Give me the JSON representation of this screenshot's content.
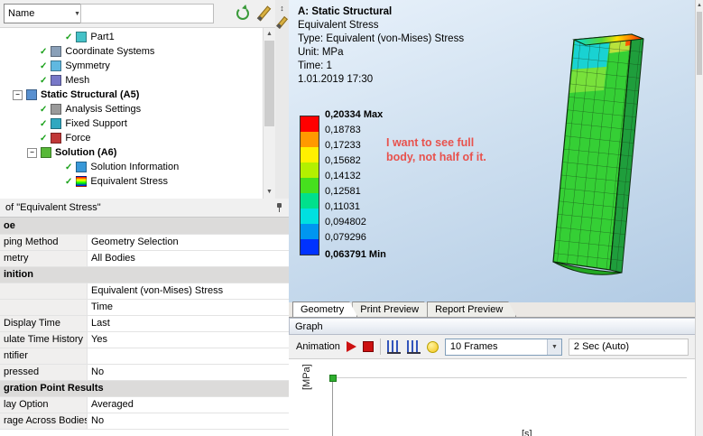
{
  "tree_panel": {
    "name_filter_label": "Name",
    "items": [
      {
        "label": "Part1"
      },
      {
        "label": "Coordinate Systems"
      },
      {
        "label": "Symmetry"
      },
      {
        "label": "Mesh"
      },
      {
        "label": "Static Structural (A5)"
      },
      {
        "label": "Analysis Settings"
      },
      {
        "label": "Fixed Support"
      },
      {
        "label": "Force"
      },
      {
        "label": "Solution (A6)"
      },
      {
        "label": "Solution Information"
      },
      {
        "label": "Equivalent Stress"
      }
    ]
  },
  "details_panel": {
    "title": "of \"Equivalent Stress\"",
    "rows": [
      {
        "label": "oe",
        "value": ""
      },
      {
        "label": "ping Method",
        "value": "Geometry Selection"
      },
      {
        "label": "metry",
        "value": "All Bodies"
      },
      {
        "label": "inition",
        "value": ""
      },
      {
        "label": "",
        "value": "Equivalent (von-Mises) Stress"
      },
      {
        "label": "",
        "value": "Time"
      },
      {
        "label": "Display Time",
        "value": "Last"
      },
      {
        "label": "ulate Time History",
        "value": "Yes"
      },
      {
        "label": "ntifier",
        "value": ""
      },
      {
        "label": "pressed",
        "value": "No"
      },
      {
        "label": "gration Point Results",
        "value": ""
      },
      {
        "label": "lay Option",
        "value": "Averaged"
      },
      {
        "label": "rage Across Bodies",
        "value": "No"
      }
    ]
  },
  "viewport": {
    "header_lines": [
      "A: Static Structural",
      "Equivalent Stress",
      "Type: Equivalent (von-Mises) Stress",
      "Unit: MPa",
      "Time: 1",
      "1.01.2019 17:30"
    ],
    "legend": {
      "values": [
        "0,20334 Max",
        "0,18783",
        "0,17233",
        "0,15682",
        "0,14132",
        "0,12581",
        "0,11031",
        "0,094802",
        "0,079296",
        "0,063791 Min"
      ],
      "colors": [
        "#ff0000",
        "#ff9900",
        "#fff000",
        "#b3f000",
        "#46e01e",
        "#00e08c",
        "#00e0e0",
        "#0096f0",
        "#0032ff"
      ]
    },
    "annotation": {
      "lines": [
        "I want to see full",
        "body, not half of it."
      ],
      "color": "#e8524d"
    },
    "tabs": [
      "Geometry",
      "Print Preview",
      "Report Preview"
    ]
  },
  "graph_panel": {
    "title": "Graph",
    "animation_label": "Animation",
    "frames_value": "10 Frames",
    "duration_value": "2 Sec (Auto)",
    "y_axis_label": "[MPa]",
    "x_axis_label": "[s]"
  }
}
